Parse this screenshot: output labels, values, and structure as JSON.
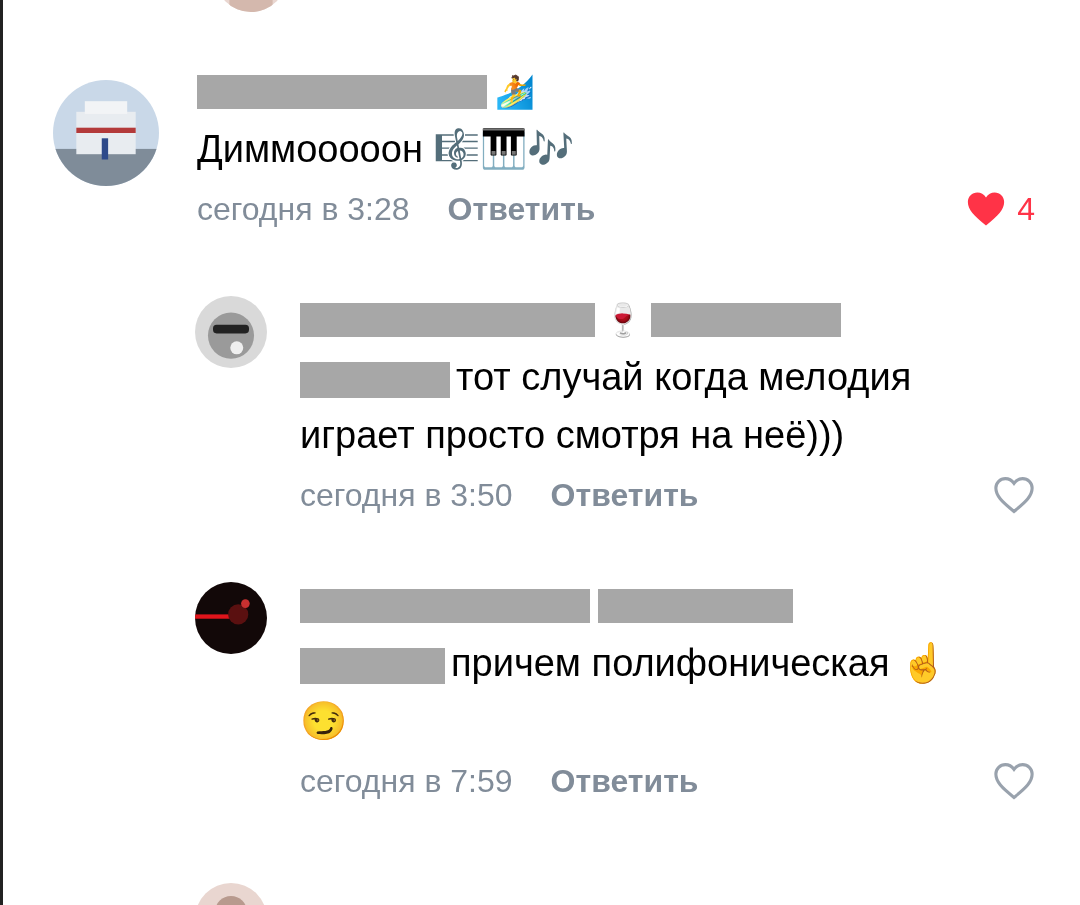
{
  "comments": [
    {
      "kind": "comment",
      "name": [
        {
          "kind": "redaction"
        },
        {
          "kind": "text",
          "text": "🏄"
        }
      ],
      "body": [
        {
          "kind": "text",
          "text": "Диммооооон 🎼🎹🎶"
        }
      ],
      "time": "сегодня в 3:28",
      "reply": "Ответить",
      "liked": true,
      "likes": "4"
    },
    {
      "kind": "reply",
      "name": [
        {
          "kind": "redaction"
        },
        {
          "kind": "text",
          "text": "🍷"
        },
        {
          "kind": "redaction"
        }
      ],
      "body": [
        {
          "kind": "redaction"
        },
        {
          "kind": "text",
          "text": "тот случай когда мелодия играет просто смотря на неё)))"
        }
      ],
      "time": "сегодня в 3:50",
      "reply": "Ответить",
      "liked": false
    },
    {
      "kind": "reply",
      "name": [
        {
          "kind": "redaction"
        },
        {
          "kind": "redaction"
        }
      ],
      "body": [
        {
          "kind": "redaction"
        },
        {
          "kind": "text",
          "text": "причем полифоническая ☝️ 😏"
        }
      ],
      "time": "сегодня в 7:59",
      "reply": "Ответить",
      "liked": false
    }
  ]
}
